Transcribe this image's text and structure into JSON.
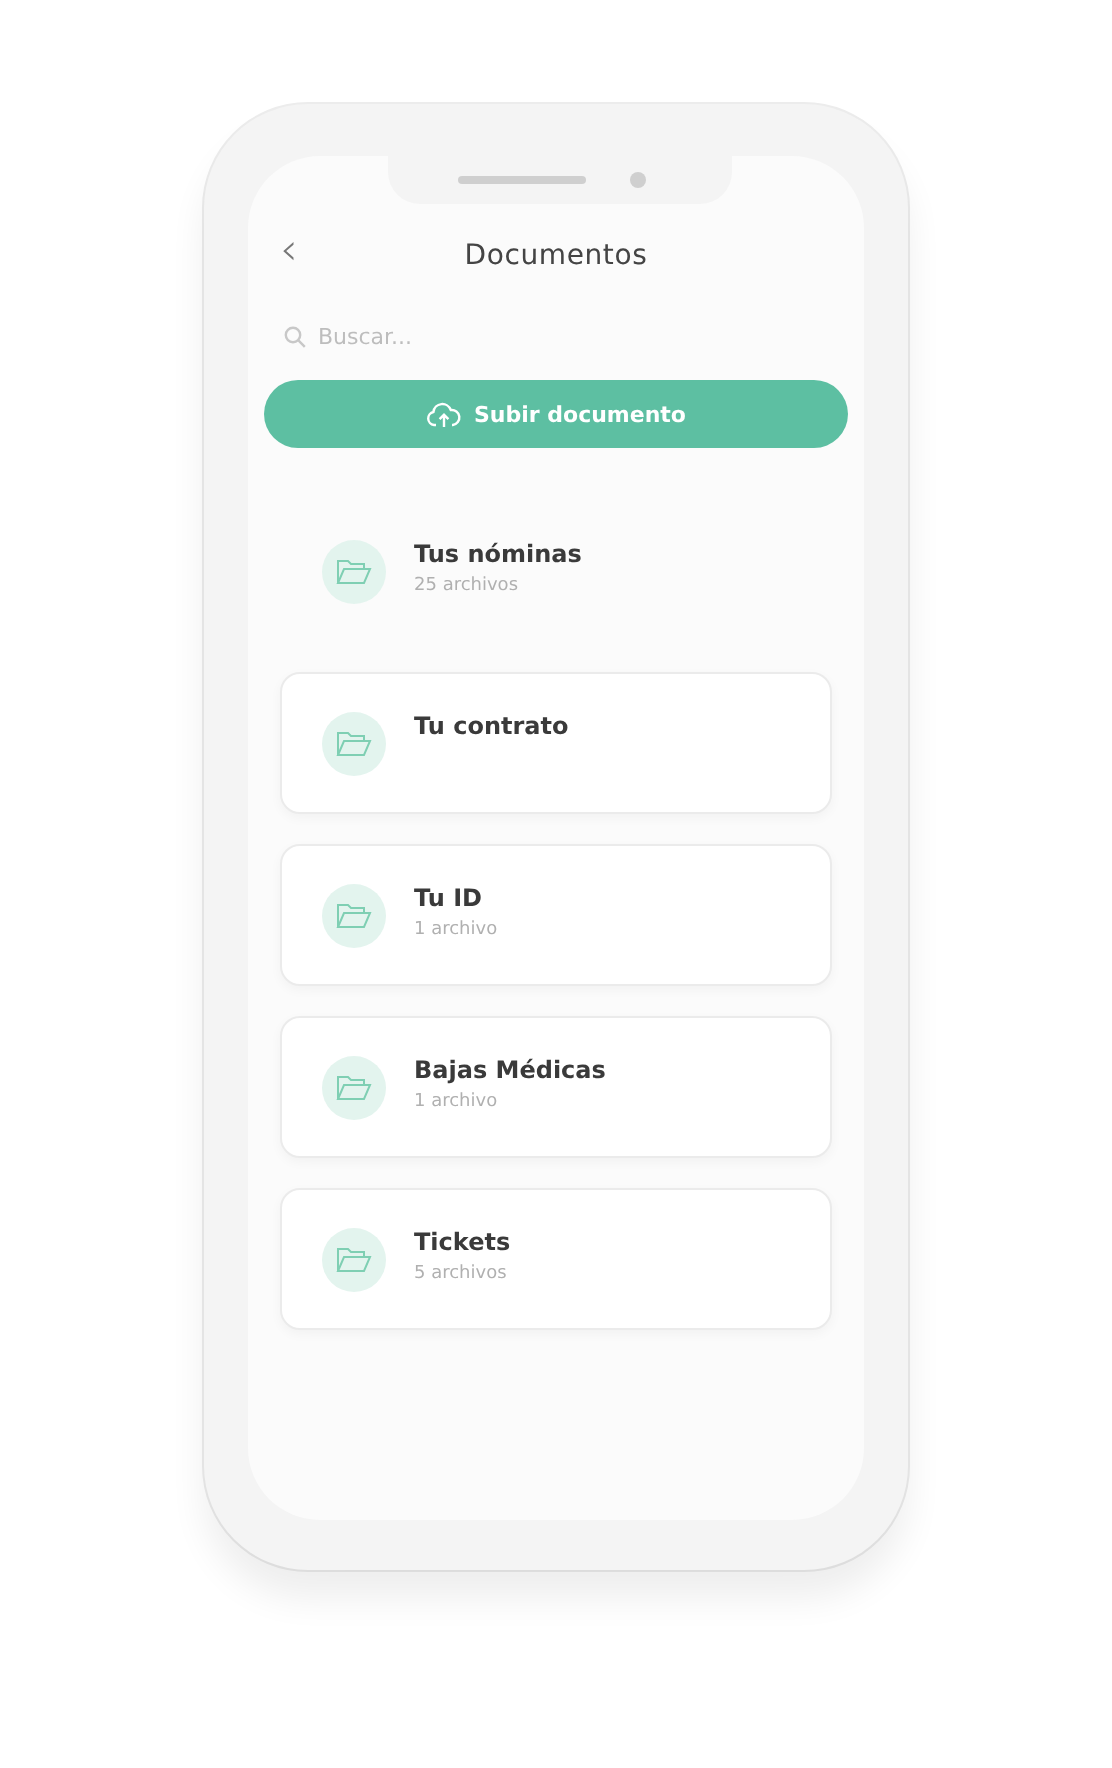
{
  "header": {
    "back": "‹",
    "title": "Documentos"
  },
  "search": {
    "placeholder": "Buscar..."
  },
  "upload_button": {
    "label": "Subir documento"
  },
  "folders": [
    {
      "kind": "plain",
      "name": "Tus nóminas",
      "count": "25 archivos"
    },
    {
      "kind": "card",
      "name": "Tu contrato"
    },
    {
      "kind": "card",
      "name": "Tu ID",
      "count": "1 archivo"
    },
    {
      "kind": "card",
      "name": "Bajas Médicas",
      "count": "1 archivo"
    },
    {
      "kind": "card",
      "name": "Tickets",
      "count": "5 archivos"
    }
  ]
}
